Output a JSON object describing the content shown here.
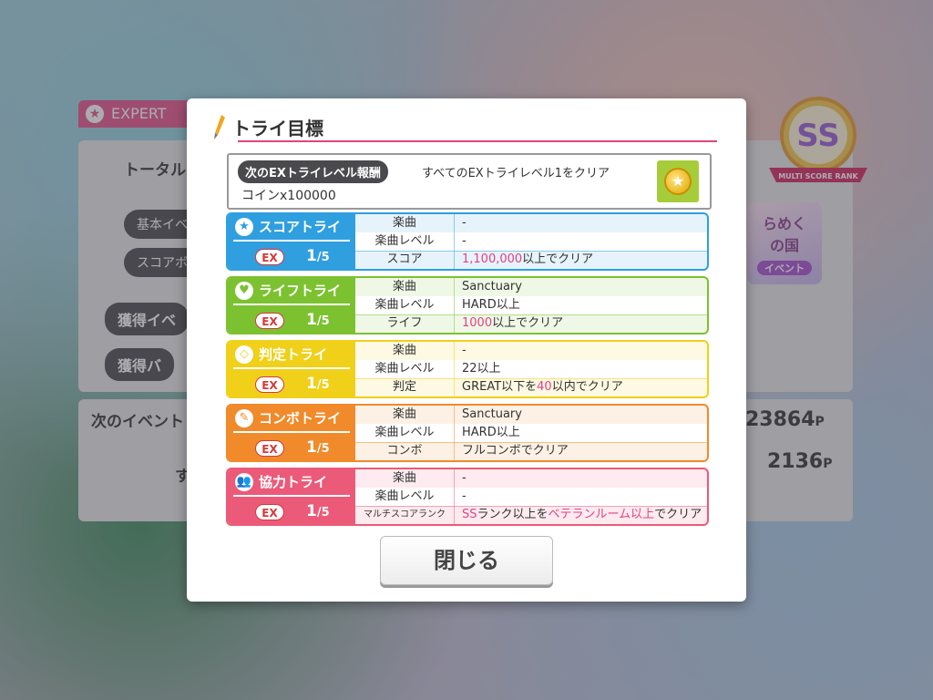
{
  "background": {
    "expert_tab": "EXPERT",
    "total_label": "トータル",
    "basic_event_label": "基本イベ",
    "score_label": "スコアボ",
    "earned_event_label": "獲得イベ",
    "earned_badge_label": "獲得バ",
    "next_event_label": "次のイベント",
    "partial_label": "す",
    "points_total": "23864",
    "points_next": "2136",
    "points_unit": "P",
    "rank_text": "MULTI SCORE RANK",
    "rank_letter": "SS",
    "event_logo_text": "らめく\nの国",
    "event_logo_sub": "イベント"
  },
  "modal": {
    "title": "トライ目標",
    "reward": {
      "tag": "次のEXトライレベル報酬",
      "condition": "すべてのEXトライレベル1をクリア",
      "value": "コインx100000"
    },
    "tries": [
      {
        "name": "スコアトライ",
        "icon": "star-icon",
        "color": "#2f9fe0",
        "ex": "EX",
        "progress_num": "1",
        "progress_den": "/5",
        "rows": [
          {
            "key": "楽曲",
            "value": "-"
          },
          {
            "key": "楽曲レベル",
            "value": "-"
          },
          {
            "key": "スコア",
            "value_hl": "1,100,000",
            "value_rest": "以上でクリア"
          }
        ]
      },
      {
        "name": "ライフトライ",
        "icon": "heart-icon",
        "color": "#7cc230",
        "ex": "EX",
        "progress_num": "1",
        "progress_den": "/5",
        "rows": [
          {
            "key": "楽曲",
            "value": "Sanctuary"
          },
          {
            "key": "楽曲レベル",
            "value": "HARD以上"
          },
          {
            "key": "ライフ",
            "value_hl": "1000",
            "value_rest": "以上でクリア"
          }
        ]
      },
      {
        "name": "判定トライ",
        "icon": "diamond-icon",
        "color": "#f0d019",
        "ex": "EX",
        "progress_num": "1",
        "progress_den": "/5",
        "rows": [
          {
            "key": "楽曲",
            "value": "-"
          },
          {
            "key": "楽曲レベル",
            "value": "22以上"
          },
          {
            "key": "判定",
            "value_pre": "GREAT以下を",
            "value_hl": "40",
            "value_rest": "以内でクリア"
          }
        ]
      },
      {
        "name": "コンボトライ",
        "icon": "brush-icon",
        "color": "#f08a2a",
        "ex": "EX",
        "progress_num": "1",
        "progress_den": "/5",
        "rows": [
          {
            "key": "楽曲",
            "value": "Sanctuary"
          },
          {
            "key": "楽曲レベル",
            "value": "HARD以上"
          },
          {
            "key": "コンボ",
            "value": "フルコンボでクリア"
          }
        ]
      },
      {
        "name": "協力トライ",
        "icon": "people-icon",
        "color": "#ec5a7a",
        "ex": "EX",
        "progress_num": "1",
        "progress_den": "/5",
        "rows": [
          {
            "key": "楽曲",
            "value": "-"
          },
          {
            "key": "楽曲レベル",
            "value": "-"
          },
          {
            "key": "マルチスコアランク",
            "value_hl": "SS",
            "value_mid": "ランク以上を",
            "value_hl2": "ベテランルーム以上",
            "value_rest": "でクリア"
          }
        ]
      }
    ],
    "close_label": "閉じる"
  }
}
